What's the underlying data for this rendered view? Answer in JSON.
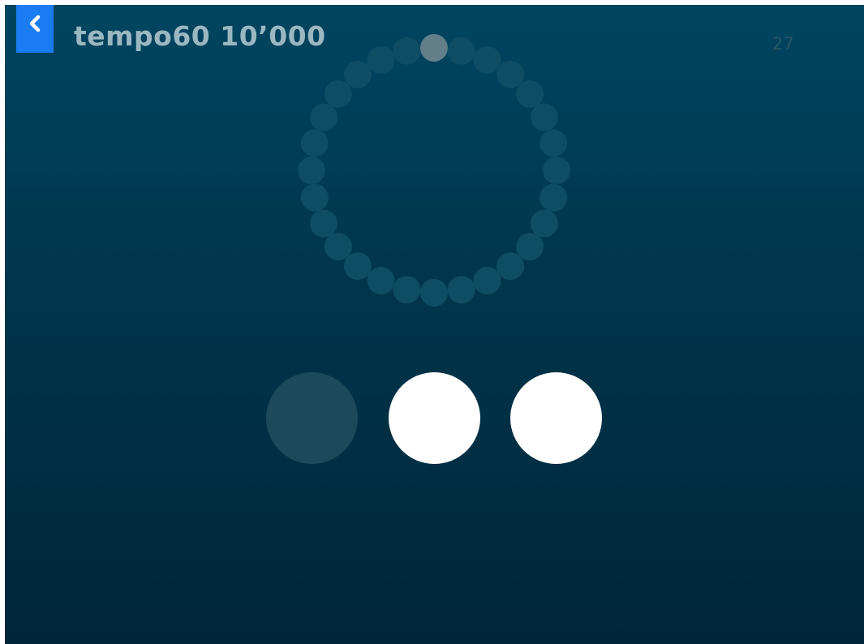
{
  "header": {
    "title": "tempo60 10’000",
    "counter": "27",
    "back_icon": "chevron-left-icon"
  },
  "ring": {
    "dot_count": 28,
    "active_index": 0
  },
  "buttons": [
    {
      "state": "dim"
    },
    {
      "state": "lit"
    },
    {
      "state": "lit"
    }
  ],
  "colors": {
    "accent": "#1a7cf2",
    "ring_dot": "#0f4d64",
    "ring_active": "#627f89",
    "button_dim": "#1c4a5a",
    "button_lit": "#ffffff",
    "title": "#9bb7c2",
    "counter": "#2a5668"
  }
}
